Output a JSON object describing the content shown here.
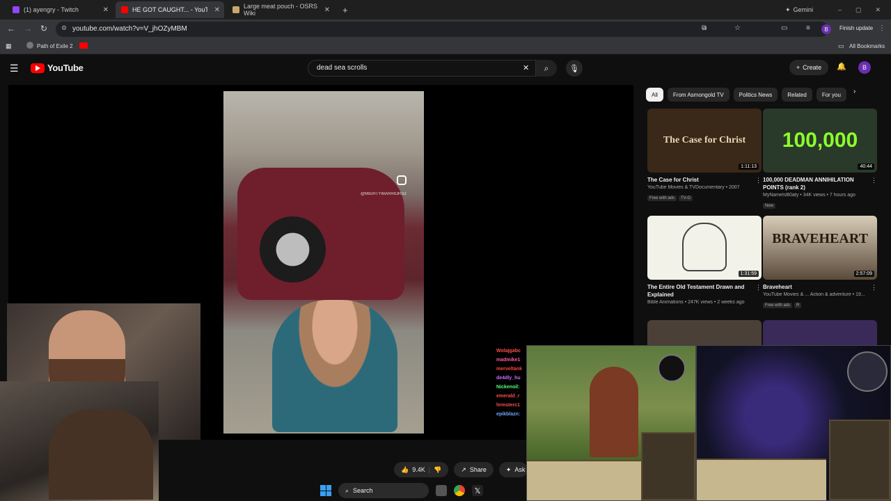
{
  "tabs": [
    {
      "label": "(1) ayengry - Twitch",
      "color": "#9146ff",
      "active": false
    },
    {
      "label": "HE GOT CAUGHT... - YouTube",
      "color": "#ff0000",
      "active": true
    },
    {
      "label": "Large meat pouch - OSRS Wiki",
      "color": "#c8a86a",
      "active": false
    }
  ],
  "new_tab": "+",
  "gemini": "Gemini",
  "address": {
    "url": "youtube.com/watch?v=V_jhOZyMBM"
  },
  "finish_update": "Finish update",
  "profile_initial": "B",
  "bookmarks": {
    "item1": "Path of Exile 2",
    "all": "All Bookmarks"
  },
  "youtube": {
    "logo_text": "YouTube",
    "search_query": "dead sea scrolls",
    "create_label": "Create",
    "avatar": "B"
  },
  "video": {
    "ig_handle": "@MIGHTYWARRIORS3"
  },
  "chat_names": [
    {
      "name": "Wolajgabc",
      "color": "#ff4d4d"
    },
    {
      "name": "madmike1",
      "color": "#ff5a9c"
    },
    {
      "name": "merveltank",
      "color": "#ff4040"
    },
    {
      "name": "de4dly_hu",
      "color": "#cc6bff"
    },
    {
      "name": "Nickenoil:",
      "color": "#5aff7c"
    },
    {
      "name": "emerald_r",
      "color": "#ff4d4d"
    },
    {
      "name": "hrmsterc1",
      "color": "#ff4d4d"
    },
    {
      "name": "epikblazn:",
      "color": "#6fa8ff"
    }
  ],
  "actions": {
    "likes": "9.4K",
    "share": "Share",
    "ask": "Ask"
  },
  "chips": [
    "All",
    "From Asmongold TV",
    "Politics News",
    "Related",
    "For you"
  ],
  "recommendations": [
    {
      "title": "The Case for Christ",
      "channel": "YouTube Movies & TVDocumentary • 2007",
      "duration": "1:11:13",
      "badges": [
        "Free with ads",
        "TV-G"
      ],
      "thumb_text": "The Case for Christ",
      "thumb_color": "#3a2818"
    },
    {
      "title": "100,000 DEADMAN ANNIHILATION POINTS (rank 2)",
      "channel": "MyNameIsB0aty • 34K views • 7 hours ago",
      "duration": "40:44",
      "badges": [
        "New"
      ],
      "thumb_text": "100,000",
      "thumb_color": "#2a3a2a"
    },
    {
      "title": "The Entire Old Testament Drawn and Explained",
      "channel": "Bible Animations • 247K views • 2 weeks ago",
      "duration": "1:31:59",
      "badges": [],
      "thumb_text": "",
      "thumb_color": "#f2f2e8"
    },
    {
      "title": "Braveheart",
      "channel": "YouTube Movies & ... Action & adventure • 19...",
      "duration": "2:57:09",
      "badges": [
        "Free with ads",
        "R"
      ],
      "thumb_text": "BRAVEHEART",
      "thumb_color": "#5a4a3a"
    }
  ],
  "taskbar": {
    "search": "Search"
  },
  "colors": {
    "youtube_red": "#ff0000",
    "bg": "#0f0f0f"
  }
}
